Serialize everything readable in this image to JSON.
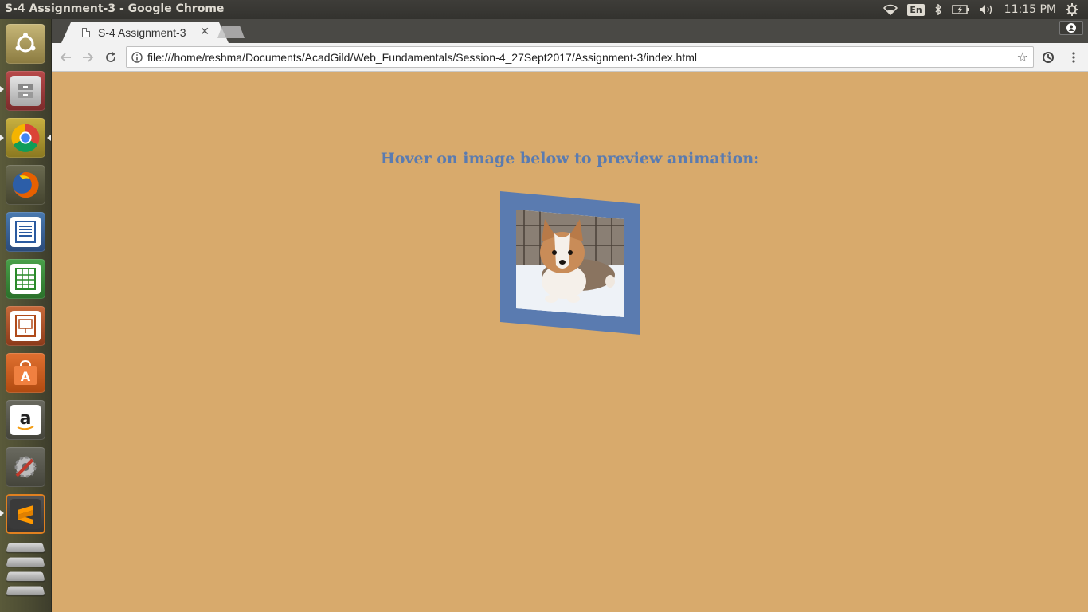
{
  "window": {
    "title": "S-4 Assignment-3 - Google Chrome"
  },
  "system_tray": {
    "keyboard_layout": "En",
    "time": "11:15 PM",
    "icons": [
      "wifi-icon",
      "bluetooth-icon",
      "battery-icon",
      "volume-icon",
      "settings-gear-icon"
    ]
  },
  "launcher": {
    "items": [
      "ubuntu-dash",
      "files",
      "chrome",
      "firefox",
      "libreoffice-writer",
      "libreoffice-calc",
      "libreoffice-impress",
      "software-center",
      "amazon",
      "system-settings",
      "sublime-text",
      "workspaces"
    ]
  },
  "browser": {
    "tab_title": "S-4 Assignment-3",
    "url": "file:///home/reshma/Documents/AcadGild/Web_Fundamentals/Session-4_27Sept2017/Assignment-3/index.html"
  },
  "page": {
    "heading": "Hover on image below to preview animation:",
    "background_color": "#d8aa6c",
    "accent_color": "#5a7bb0",
    "image_description_icon": "corgi-puppy-photo"
  }
}
